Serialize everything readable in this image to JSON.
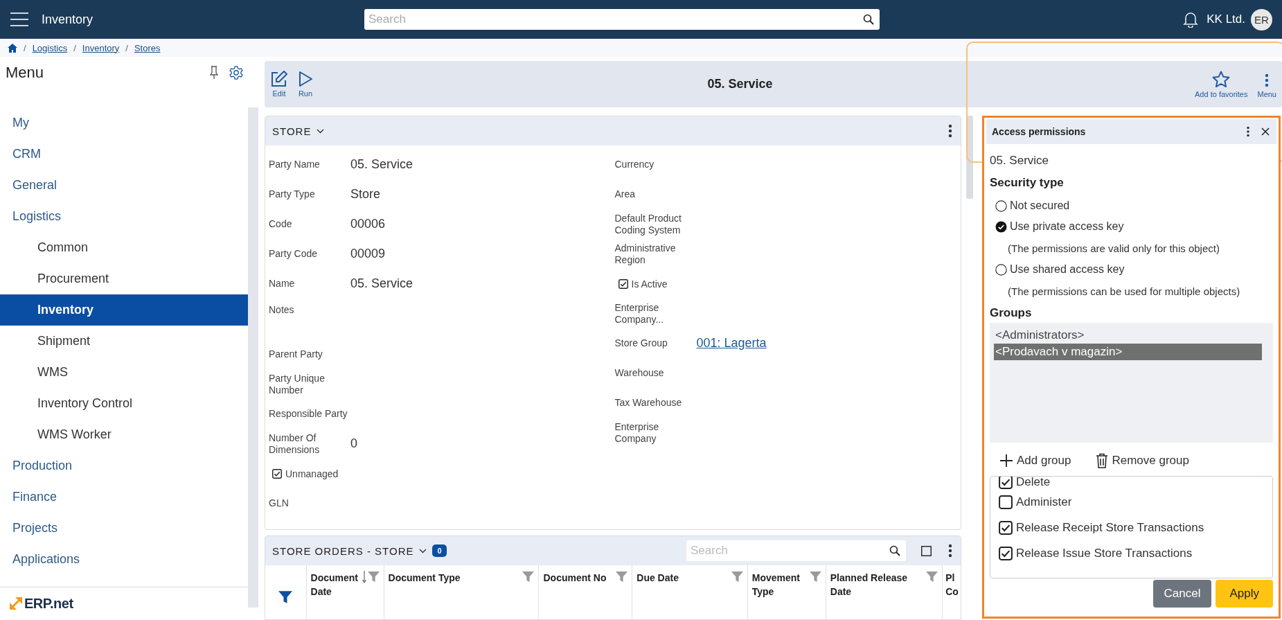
{
  "topbar": {
    "title": "Inventory",
    "search_placeholder": "Search",
    "company": "KK Ltd.",
    "avatar": "ER"
  },
  "breadcrumb": {
    "separator": "/",
    "items": [
      "Logistics",
      "Inventory",
      "Stores"
    ]
  },
  "sidebar": {
    "title": "Menu",
    "logo": "ERP.net",
    "items": [
      {
        "label": "My",
        "selected": false
      },
      {
        "label": "CRM",
        "selected": false
      },
      {
        "label": "General",
        "selected": false
      },
      {
        "label": "Logistics",
        "selected": false,
        "children": [
          {
            "label": "Common",
            "selected": false
          },
          {
            "label": "Procurement",
            "selected": false
          },
          {
            "label": "Inventory",
            "selected": true
          },
          {
            "label": "Shipment",
            "selected": false
          },
          {
            "label": "WMS",
            "selected": false
          },
          {
            "label": "Inventory Control",
            "selected": false
          },
          {
            "label": "WMS Worker",
            "selected": false
          }
        ]
      },
      {
        "label": "Production",
        "selected": false
      },
      {
        "label": "Finance",
        "selected": false
      },
      {
        "label": "Projects",
        "selected": false
      },
      {
        "label": "Applications",
        "selected": false
      }
    ]
  },
  "toolbar": {
    "title": "05. Service",
    "buttons": [
      {
        "label": "Edit",
        "kind": "edit"
      },
      {
        "label": "Run",
        "kind": "run"
      }
    ],
    "right_buttons": [
      {
        "label": "Add to favorites",
        "kind": "star"
      },
      {
        "label": "Menu",
        "kind": "kebab"
      }
    ]
  },
  "store": {
    "title": "STORE",
    "columns": [
      [
        {
          "kind": "text",
          "label": "Party Name",
          "value": "05. Service"
        },
        {
          "kind": "text",
          "label": "Party Type",
          "value": "Store"
        },
        {
          "kind": "text",
          "label": "Code",
          "value": "00006"
        },
        {
          "kind": "text",
          "label": "Party Code",
          "value": "00009"
        },
        {
          "kind": "text",
          "label": "Name",
          "value": "05. Service"
        },
        {
          "kind": "memo",
          "label": "Notes"
        },
        {
          "kind": "text",
          "label": "Parent Party"
        },
        {
          "kind": "text",
          "label": "Party Unique Number"
        },
        {
          "kind": "text",
          "label": "Responsible Party"
        },
        {
          "kind": "text",
          "label": "Number Of Dimensions",
          "value": "0"
        },
        {
          "kind": "checkbox",
          "label": "Unmanaged",
          "checked": true
        },
        {
          "kind": "text",
          "label": "GLN"
        }
      ],
      [
        {
          "kind": "text",
          "label": "Currency"
        },
        {
          "kind": "text",
          "label": "Area"
        },
        {
          "kind": "text",
          "label": "Default Product Coding System"
        },
        {
          "kind": "text",
          "label": "Administrative Region"
        },
        {
          "kind": "checkbox",
          "label": "Is Active",
          "checked": true
        },
        {
          "kind": "text",
          "label": "Enterprise Company..."
        },
        {
          "kind": "link",
          "label": "Store Group",
          "value": "001: Lagerta"
        },
        {
          "kind": "text",
          "label": "Warehouse"
        },
        {
          "kind": "text",
          "label": "Tax Warehouse"
        },
        {
          "kind": "text",
          "label": "Enterprise Company"
        }
      ]
    ]
  },
  "orders": {
    "title": "STORE ORDERS - STORE",
    "count": "0",
    "search_placeholder": "Search",
    "columns": [
      {
        "label": "Document Date",
        "sorted": true
      },
      {
        "label": "Document Type",
        "sorted": false
      },
      {
        "label": "Document No",
        "sorted": false
      },
      {
        "label": "Due Date",
        "sorted": false
      },
      {
        "label": "Movement Type",
        "sorted": false
      },
      {
        "label": "Planned Release Date",
        "sorted": false
      },
      {
        "label": "Pl Co",
        "sorted": false
      }
    ]
  },
  "access_panel": {
    "title": "Access permissions",
    "object": "05. Service",
    "security_title": "Security type",
    "security_types": [
      {
        "label": "Not secured",
        "selected": false
      },
      {
        "label": "Use private access key",
        "selected": true,
        "note": "(The permissions are valid only for this object)"
      },
      {
        "label": "Use shared access key",
        "selected": false,
        "note": "(The permissions can be used for multiple objects)"
      }
    ],
    "groups_title": "Groups",
    "groups": [
      {
        "label": "<Administrators>",
        "selected": false
      },
      {
        "label": "<Prodavach v magazin>",
        "selected": true
      }
    ],
    "group_actions": [
      {
        "label": "Add group",
        "kind": "add"
      },
      {
        "label": "Remove group",
        "kind": "remove"
      }
    ],
    "permissions": [
      {
        "label": "Delete",
        "checked": true
      },
      {
        "label": "Administer",
        "checked": false
      },
      {
        "label": "Release Receipt Store Transactions",
        "checked": true
      },
      {
        "label": "Release Issue Store Transactions",
        "checked": true
      }
    ],
    "buttons": [
      {
        "label": "Cancel",
        "kind": "secondary"
      },
      {
        "label": "Apply",
        "kind": "primary"
      }
    ]
  }
}
